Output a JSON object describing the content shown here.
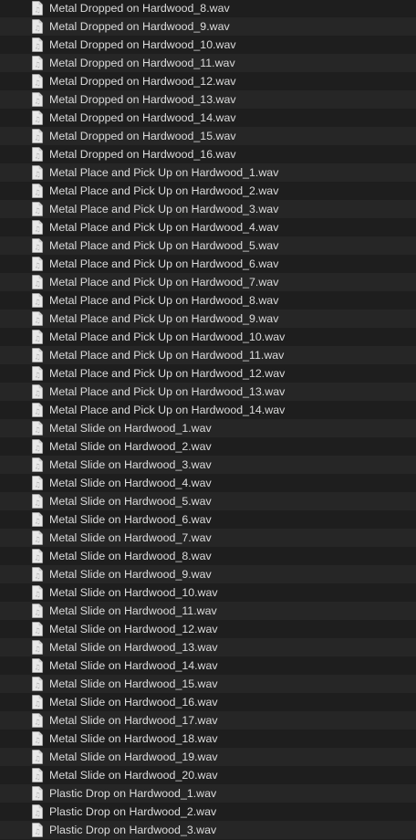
{
  "colors": {
    "background": "#1e1e1e",
    "row_alt": "#262626",
    "text": "#dcdcdc",
    "icon_paper": "#e9e9e9"
  },
  "icon": "audio-file-icon",
  "files": [
    "Metal Dropped on Hardwood_8.wav",
    "Metal Dropped on Hardwood_9.wav",
    "Metal Dropped on Hardwood_10.wav",
    "Metal Dropped on Hardwood_11.wav",
    "Metal Dropped on Hardwood_12.wav",
    "Metal Dropped on Hardwood_13.wav",
    "Metal Dropped on Hardwood_14.wav",
    "Metal Dropped on Hardwood_15.wav",
    "Metal Dropped on Hardwood_16.wav",
    "Metal Place and Pick Up on Hardwood_1.wav",
    "Metal Place and Pick Up on Hardwood_2.wav",
    "Metal Place and Pick Up on Hardwood_3.wav",
    "Metal Place and Pick Up on Hardwood_4.wav",
    "Metal Place and Pick Up on Hardwood_5.wav",
    "Metal Place and Pick Up on Hardwood_6.wav",
    "Metal Place and Pick Up on Hardwood_7.wav",
    "Metal Place and Pick Up on Hardwood_8.wav",
    "Metal Place and Pick Up on Hardwood_9.wav",
    "Metal Place and Pick Up on Hardwood_10.wav",
    "Metal Place and Pick Up on Hardwood_11.wav",
    "Metal Place and Pick Up on Hardwood_12.wav",
    "Metal Place and Pick Up on Hardwood_13.wav",
    "Metal Place and Pick Up on Hardwood_14.wav",
    "Metal Slide on Hardwood_1.wav",
    "Metal Slide on Hardwood_2.wav",
    "Metal Slide on Hardwood_3.wav",
    "Metal Slide on Hardwood_4.wav",
    "Metal Slide on Hardwood_5.wav",
    "Metal Slide on Hardwood_6.wav",
    "Metal Slide on Hardwood_7.wav",
    "Metal Slide on Hardwood_8.wav",
    "Metal Slide on Hardwood_9.wav",
    "Metal Slide on Hardwood_10.wav",
    "Metal Slide on Hardwood_11.wav",
    "Metal Slide on Hardwood_12.wav",
    "Metal Slide on Hardwood_13.wav",
    "Metal Slide on Hardwood_14.wav",
    "Metal Slide on Hardwood_15.wav",
    "Metal Slide on Hardwood_16.wav",
    "Metal Slide on Hardwood_17.wav",
    "Metal Slide on Hardwood_18.wav",
    "Metal Slide on Hardwood_19.wav",
    "Metal Slide on Hardwood_20.wav",
    "Plastic Drop on Hardwood_1.wav",
    "Plastic Drop on Hardwood_2.wav",
    "Plastic Drop on Hardwood_3.wav"
  ]
}
